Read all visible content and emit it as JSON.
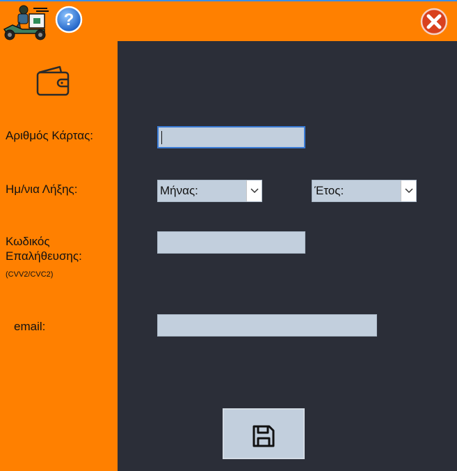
{
  "header": {
    "logo_icon": "delivery-scooter-icon",
    "help_icon": "help-icon",
    "close_icon": "close-icon",
    "accent": "#FF8000",
    "close_color": "#D9411E"
  },
  "sidebar": {
    "wallet_icon": "wallet-icon",
    "card_number_label": "Αριθμός Κάρτας:",
    "expiry_label": "Ημ/νια Λήξης:",
    "cvv_label_line1": "Κωδικός",
    "cvv_label_line2": "Επαλήθευσης:",
    "cvv_hint": "(CVV2/CVC2)",
    "email_label": "email:"
  },
  "form": {
    "card_number_value": "",
    "month_select": "Μήνας:",
    "year_select": "Έτος:",
    "cvv_value": "",
    "email_value": "",
    "panel_color": "#2B2E38",
    "field_color": "#C2CFDD"
  },
  "actions": {
    "save_icon": "floppy-disk-save-icon"
  }
}
